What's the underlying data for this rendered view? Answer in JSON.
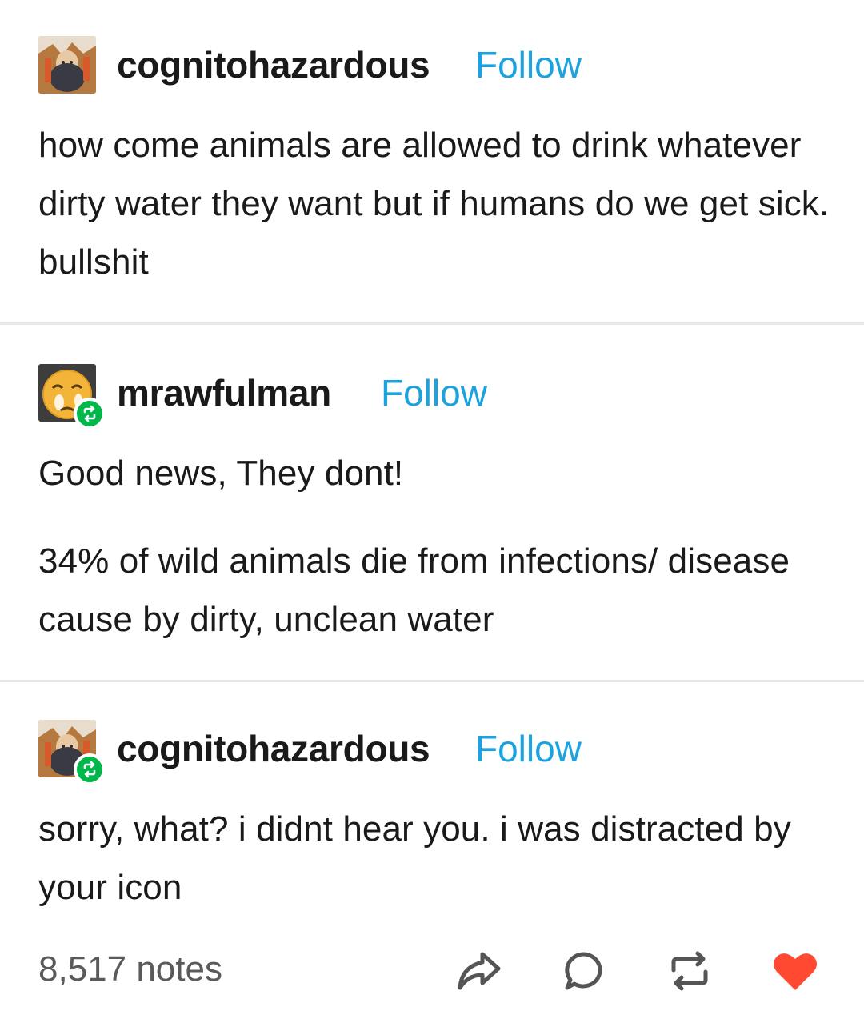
{
  "posts": [
    {
      "username": "cognitohazardous",
      "follow_label": "Follow",
      "paragraphs": [
        "how come animals are allowed to drink whatever dirty water they want but if humans do we get sick. bullshit"
      ]
    },
    {
      "username": "mrawfulman",
      "follow_label": "Follow",
      "paragraphs": [
        "Good news, They dont!",
        "34% of wild animals die from infections/ disease cause by dirty, unclean water"
      ]
    },
    {
      "username": "cognitohazardous",
      "follow_label": "Follow",
      "paragraphs": [
        "sorry, what? i didnt hear you. i was distracted by your icon"
      ]
    }
  ],
  "footer": {
    "notes": "8,517 notes",
    "icons": [
      "share-icon",
      "comment-icon",
      "reblog-icon",
      "like-heart-icon"
    ]
  },
  "colors": {
    "follow": "#1ba3e0",
    "reblog_badge": "#00b84a",
    "heart": "#ff4930",
    "notes": "#5a5a5a"
  }
}
